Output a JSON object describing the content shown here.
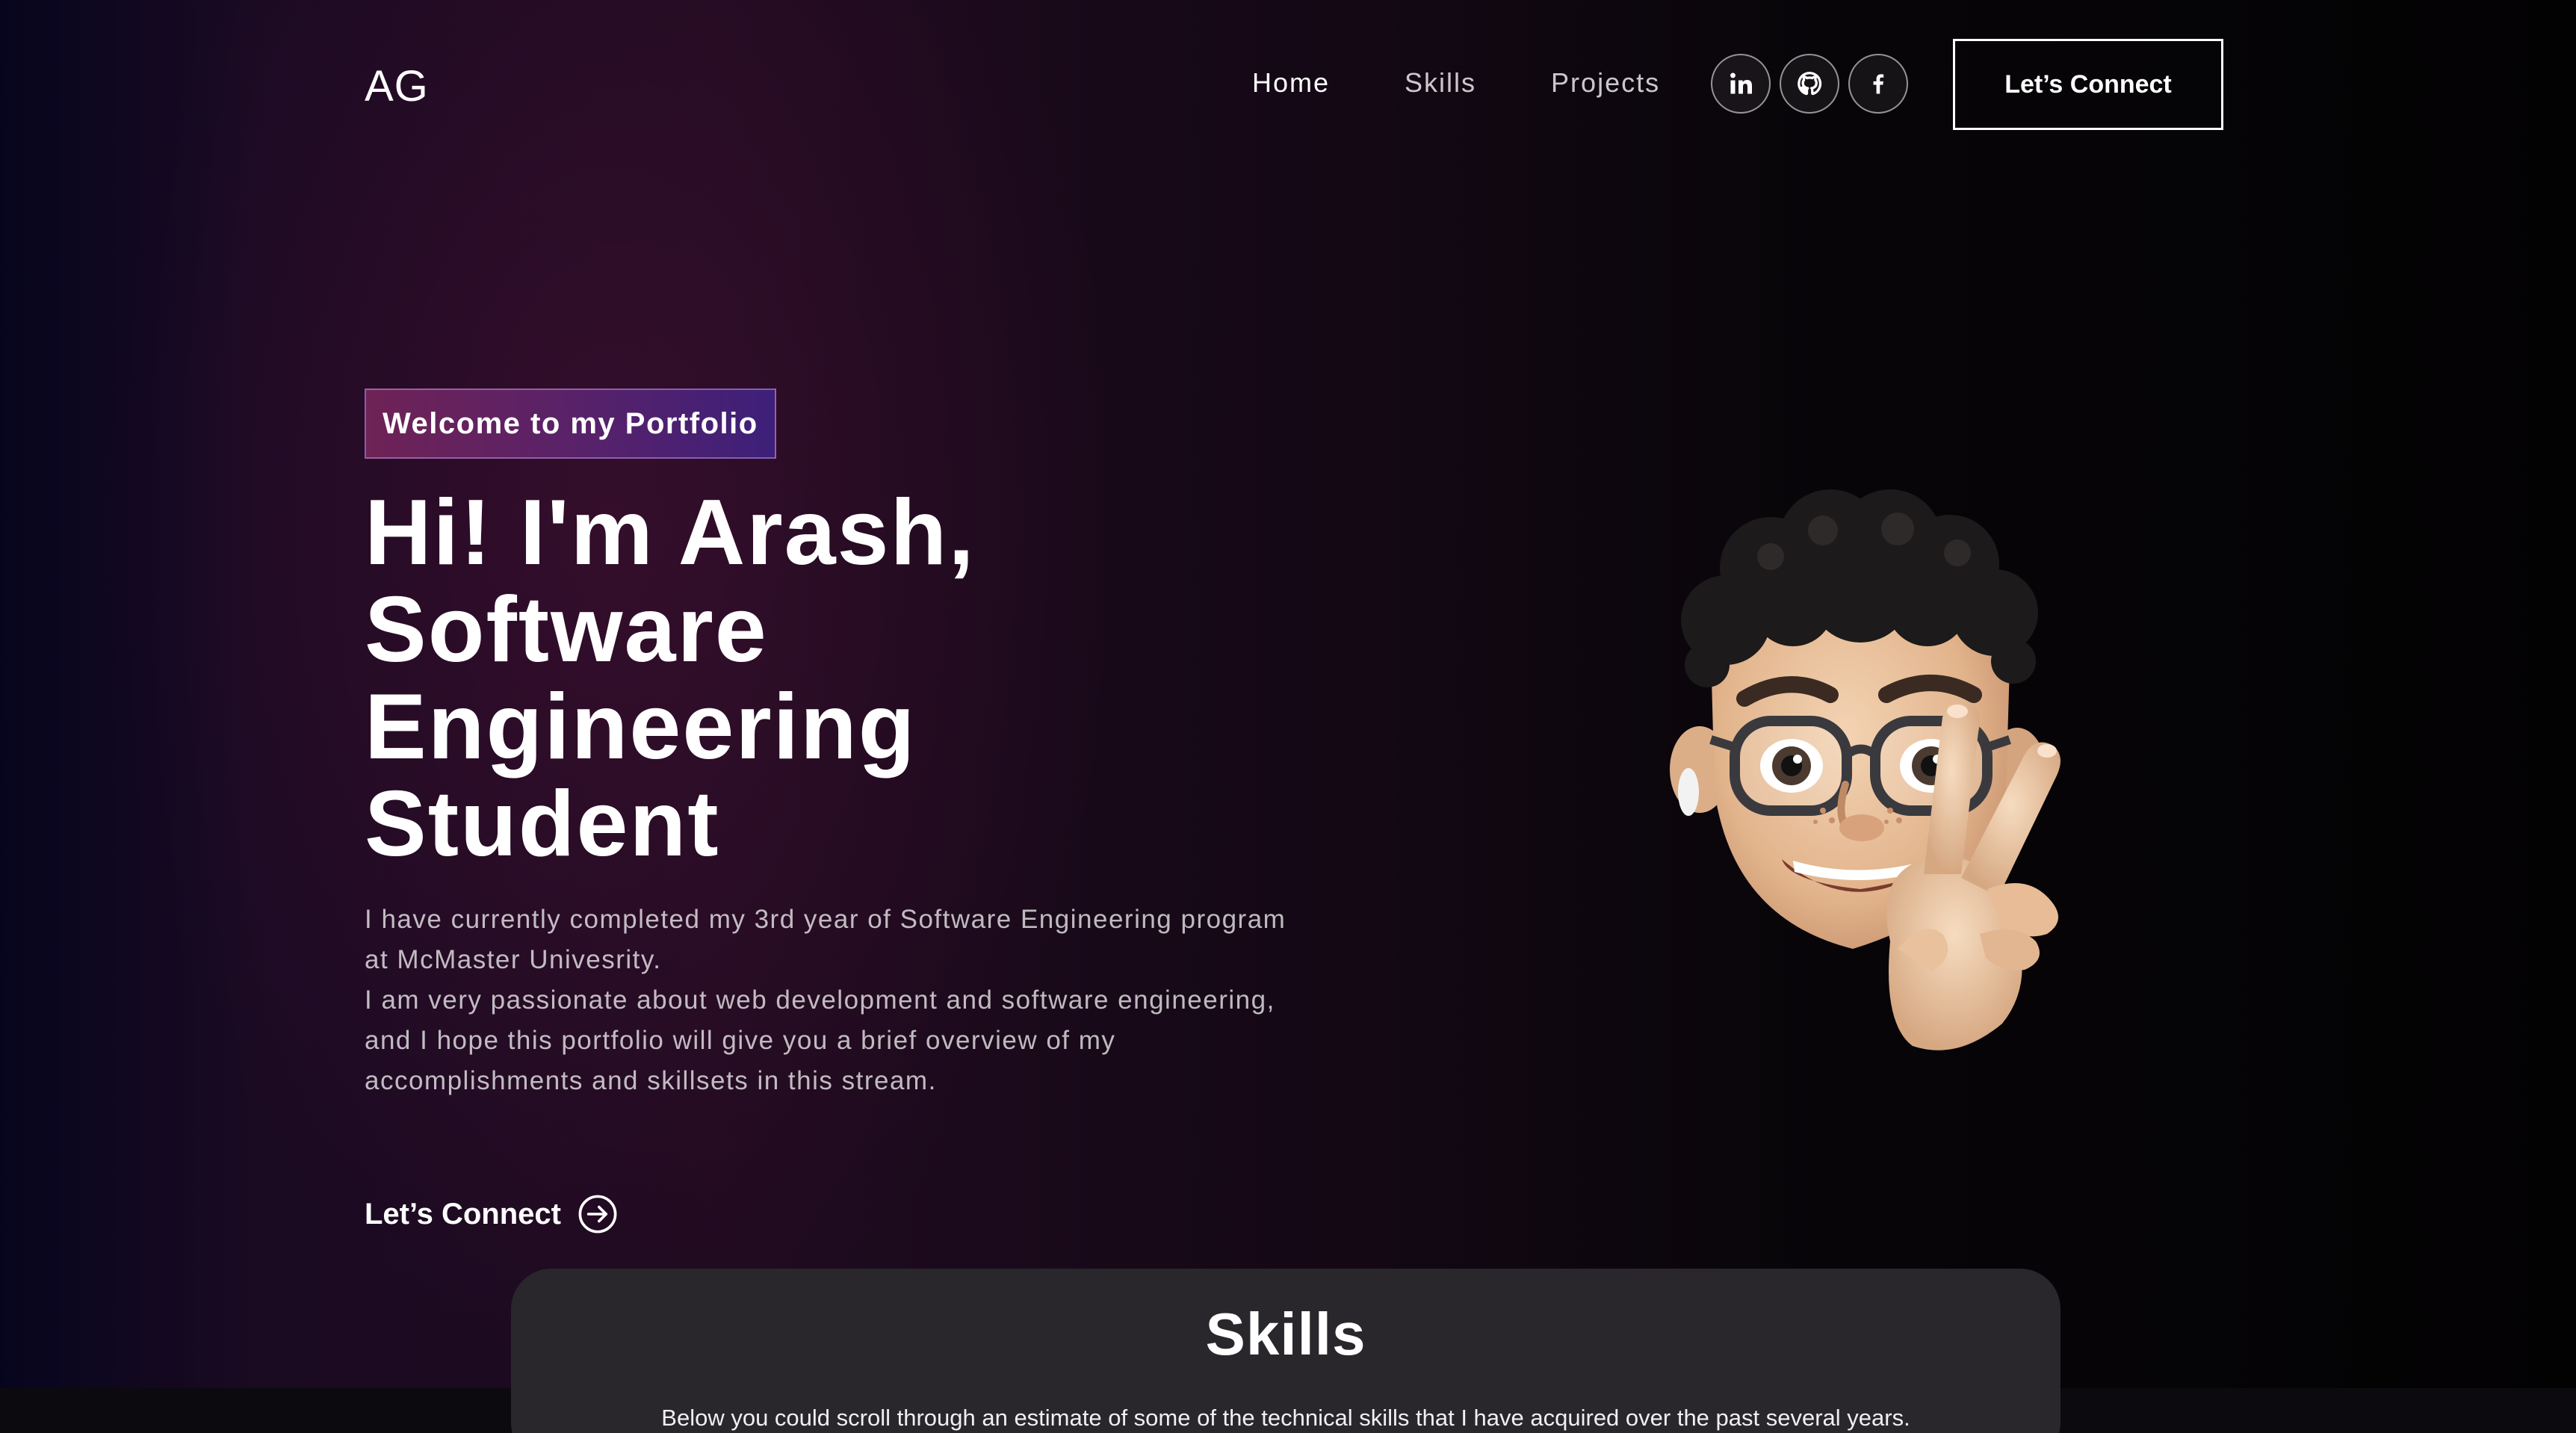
{
  "nav": {
    "logo": "AG",
    "links": [
      "Home",
      "Skills",
      "Projects"
    ],
    "socials": [
      {
        "name": "linkedin",
        "icon": "linkedin-icon"
      },
      {
        "name": "github",
        "icon": "github-icon"
      },
      {
        "name": "facebook",
        "icon": "facebook-icon"
      }
    ],
    "connect_label": "Let’s Connect"
  },
  "hero": {
    "tagline": "Welcome to my Portfolio",
    "headline": [
      "Hi! I'm Arash,",
      "Software",
      "Engineering",
      "Student"
    ],
    "bio_1": "I have currently completed my 3rd year of Software Engineering program at McMaster Univesrity.",
    "bio_2": "I am very passionate about web development and software engineering, and I hope this portfolio will give you a brief overview of my accomplishments and skillsets in this stream.",
    "connect_label": "Let’s Connect",
    "connect_icon": "arrow-right-circle-icon"
  },
  "skills": {
    "title": "Skills",
    "description": "Below you could scroll through an estimate of some of the technical skills that I have acquired over the past several years."
  },
  "colors": {
    "tagline_gradient_start": "#aa367c",
    "tagline_gradient_end": "#4a2fbd",
    "skills_card_bg": "#29262c"
  }
}
